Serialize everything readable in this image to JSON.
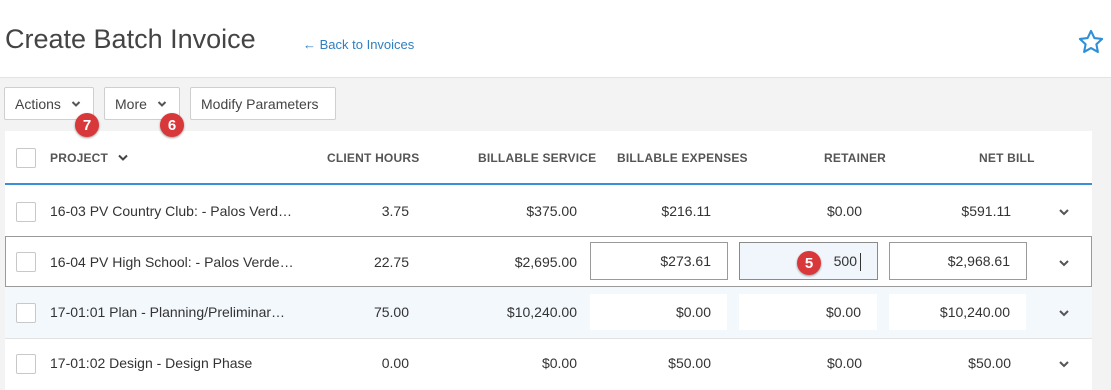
{
  "header": {
    "title": "Create Batch Invoice",
    "back_link": "← Back to Invoices",
    "favorite_icon": "star-outline-icon"
  },
  "toolbar": {
    "actions_label": "Actions",
    "more_label": "More",
    "modify_label": "Modify Parameters"
  },
  "markers": {
    "actions": "7",
    "more": "6",
    "retainer": "5"
  },
  "table": {
    "columns": {
      "project": "PROJECT",
      "client_hours": "CLIENT HOURS",
      "billable_service": "BILLABLE SERVICE",
      "billable_expenses": "BILLABLE EXPENSES",
      "retainer": "RETAINER",
      "net_bill": "NET BILL"
    },
    "rows": [
      {
        "project": "16-03 PV Country Club: - Palos Verd…",
        "client_hours": "3.75",
        "billable_service": "$375.00",
        "billable_expenses": "$216.11",
        "retainer": "$0.00",
        "net_bill": "$591.11"
      },
      {
        "project": "16-04 PV High School: - Palos Verde…",
        "client_hours": "22.75",
        "billable_service": "$2,695.00",
        "billable_expenses": "$273.61",
        "retainer": "500",
        "net_bill": "$2,968.61"
      },
      {
        "project": "17-01:01 Plan - Planning/Preliminar…",
        "client_hours": "75.00",
        "billable_service": "$10,240.00",
        "billable_expenses": "$0.00",
        "retainer": "$0.00",
        "net_bill": "$10,240.00"
      },
      {
        "project": "17-01:02 Design - Design Phase",
        "client_hours": "0.00",
        "billable_service": "$0.00",
        "billable_expenses": "$50.00",
        "retainer": "$0.00",
        "net_bill": "$50.00"
      }
    ]
  },
  "colors": {
    "accent": "#3a8fd8",
    "marker": "#d9383a",
    "highlight_row": "#f3f8fd"
  }
}
